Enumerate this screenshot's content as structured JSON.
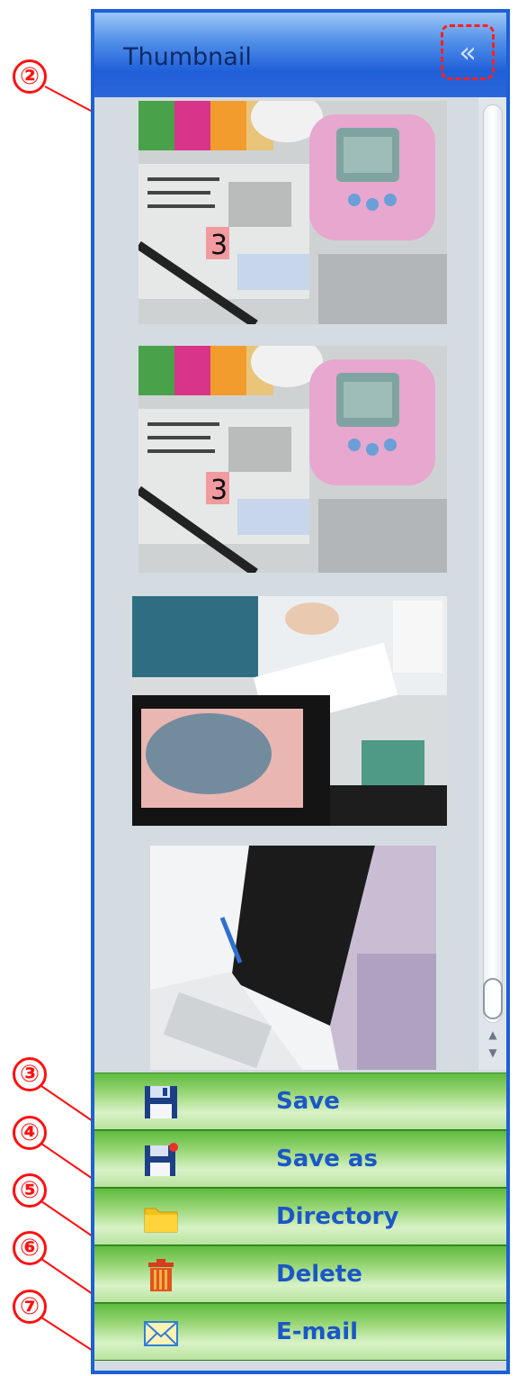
{
  "panel": {
    "title": "Thumbnail",
    "collapse_glyph": "«"
  },
  "thumbnails": [
    {
      "name": "thumbnail-1",
      "number_label": "3"
    },
    {
      "name": "thumbnail-2",
      "number_label": "3"
    },
    {
      "name": "thumbnail-3"
    },
    {
      "name": "thumbnail-4"
    }
  ],
  "actions": [
    {
      "label": "Save",
      "icon": "floppy-disk-icon"
    },
    {
      "label": "Save as",
      "icon": "floppy-disk-star-icon"
    },
    {
      "label": "Directory",
      "icon": "folder-icon"
    },
    {
      "label": "Delete",
      "icon": "trash-can-icon"
    },
    {
      "label": "E-mail",
      "icon": "envelope-icon"
    }
  ],
  "callouts": [
    "②",
    "③",
    "④",
    "⑤",
    "⑥",
    "⑦"
  ],
  "colors": {
    "panel_border": "#1c5fd6",
    "header_blue": "#1f5fd9",
    "action_green": "#5fbb3f",
    "action_text": "#1a57c7",
    "annotation_red": "#ff1010"
  }
}
